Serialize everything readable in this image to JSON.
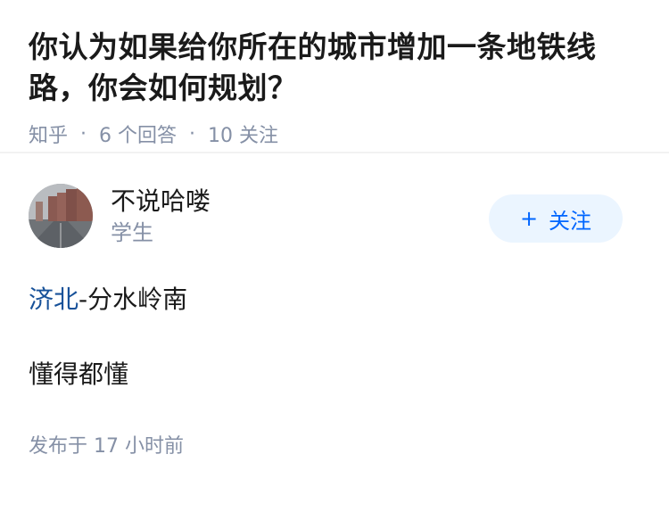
{
  "question": {
    "title": "你认为如果给你所在的城市增加一条地铁线路，你会如何规划？",
    "source": "知乎",
    "separator": "·",
    "answers_count": "6 个回答",
    "followers_count": "10 关注"
  },
  "answer": {
    "author_name": "不说哈喽",
    "author_bio": "学生",
    "avatar_icon": "avatar-photo",
    "follow_label": "关注",
    "follow_icon": "+",
    "content_link": "济北",
    "content_rest": "-分水岭南",
    "content_line2": "懂得都懂",
    "published": "发布于  17 小时前"
  },
  "colors": {
    "accent": "#0066ff",
    "link": "#175199",
    "meta": "#8590a6",
    "follow_bg": "#ebf5ff"
  }
}
